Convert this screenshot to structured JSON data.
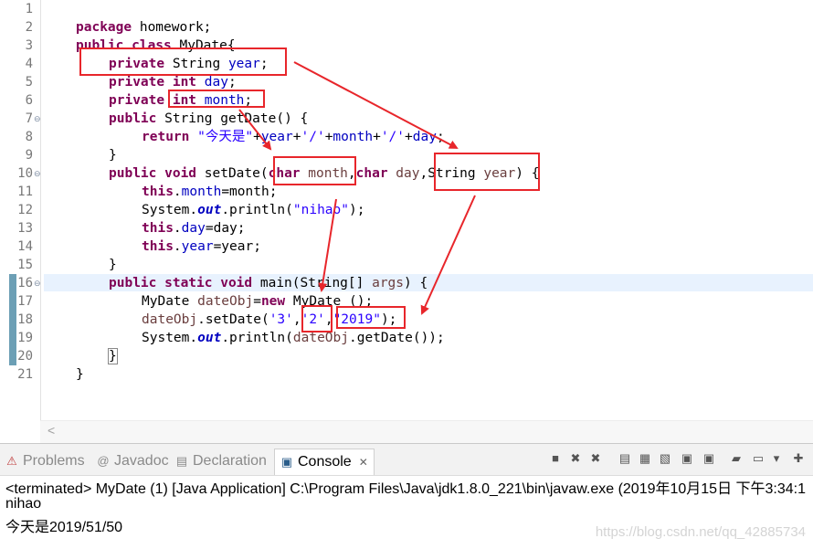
{
  "editor": {
    "line_numbers": [
      "1",
      "2",
      "3",
      "4",
      "5",
      "6",
      "7",
      "8",
      "9",
      "10",
      "11",
      "12",
      "13",
      "14",
      "15",
      "16",
      "17",
      "18",
      "19",
      "20",
      "21"
    ],
    "code": {
      "l2": {
        "kw": "package",
        "rest": " homework;"
      },
      "l3": {
        "kw": "public class",
        "rest": " MyDate{"
      },
      "l4": {
        "kw": "private",
        "t": " String ",
        "f": "year",
        "e": ";"
      },
      "l5": {
        "kw1": "private",
        "kw2": " int",
        "t": " ",
        "f": "day",
        "e": ";"
      },
      "l6": {
        "kw1": "private",
        "kw2": " int",
        "t": " ",
        "f": "month",
        "e": ";"
      },
      "l7": {
        "kw": "public",
        "rest": " String getDate() {"
      },
      "l8": {
        "kw": "return",
        "s1": " \"今天是\"",
        "p1": "+",
        "f1": "year",
        "p2": "+",
        "s2": "'/'",
        "p3": "+",
        "f2": "month",
        "p4": "+",
        "s3": "'/'",
        "p5": "+",
        "f3": "day",
        "e": ";"
      },
      "l9": {
        "rest": "}"
      },
      "l10": {
        "kw1": "public void",
        "a": " setDate(",
        "kw2": "char",
        "p1": " month",
        ",": ",",
        "kw3": "char",
        "p2": " day",
        ",2": ",",
        "t": "String ",
        "p3": "year",
        "e": ") {"
      },
      "l11": {
        "kw": "this",
        "d": ".",
        "f": "month",
        "e": "=month;"
      },
      "l12": {
        "a": "System.",
        "st": "out",
        "e": ".println(",
        "s": "\"nihao\"",
        "e2": ");"
      },
      "l13": {
        "kw": "this",
        "d": ".",
        "f": "day",
        "e": "=day;"
      },
      "l14": {
        "kw": "this",
        "d": ".",
        "f": "year",
        "e": "=year;"
      },
      "l15": {
        "rest": "}"
      },
      "l16": {
        "kw": "public static void",
        "a": " main(String[] ",
        "p": "args",
        "e": ") {"
      },
      "l17": {
        "a": "MyDate ",
        "p": "dateObj",
        "b": "=",
        "kw": "new",
        "e": " MyDate ();"
      },
      "l18": {
        "p": "dateObj",
        "a": ".setDate(",
        "s1": "'3'",
        ",": ",",
        "s2": "'2'",
        ",2": ",",
        "s3": "\"2019\"",
        "e": ");"
      },
      "l19": {
        "a": "System.",
        "st": "out",
        "b": ".println(",
        "p": "dateObj",
        "e": ".getDate());"
      },
      "l20": {
        "rest": "}"
      },
      "l21": {
        "rest": "}"
      }
    }
  },
  "tabs": [
    {
      "label": "Problems",
      "icon": "problems-icon"
    },
    {
      "label": "Javadoc",
      "icon": "javadoc-icon"
    },
    {
      "label": "Declaration",
      "icon": "declaration-icon"
    },
    {
      "label": "Console",
      "icon": "console-icon",
      "active": true,
      "close": "✕"
    }
  ],
  "console": {
    "header": "<terminated> MyDate (1) [Java Application] C:\\Program Files\\Java\\jdk1.8.0_221\\bin\\javaw.exe (2019年10月15日 下午3:34:1",
    "lines": [
      "nihao",
      "今天是2019/51/50"
    ]
  },
  "watermark": "https://blog.csdn.net/qq_42885734",
  "colors": {
    "keyword": "#7f0055",
    "field": "#0000c0",
    "string": "#2a00ff",
    "param": "#6a3e3e",
    "annotation": "#e8262b"
  }
}
